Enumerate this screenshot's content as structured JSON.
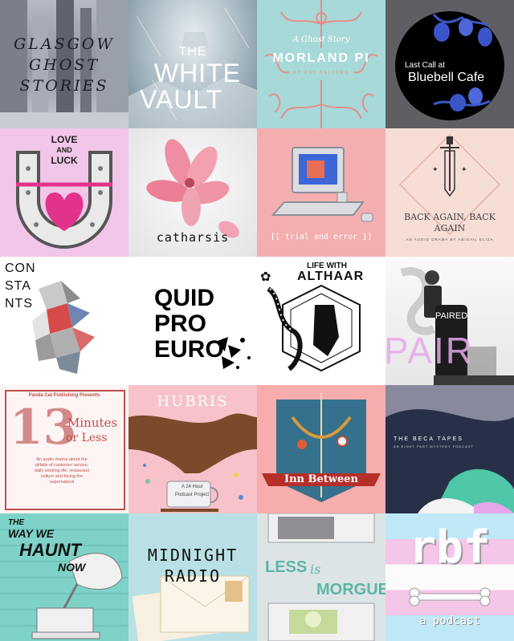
{
  "tiles": [
    {
      "name": "glasgow-ghost-stories",
      "lines": [
        "GLASGOW",
        "GHOST",
        "STORIES"
      ]
    },
    {
      "name": "the-white-vault",
      "lines": [
        "THE",
        "WHITE",
        "VAULT"
      ]
    },
    {
      "name": "morland-pi",
      "subtitle": "A Ghost Story",
      "title": "MORLAND PI",
      "byline": "BY RAY SELLERS"
    },
    {
      "name": "last-call-bluebell-cafe",
      "line1": "Last Call at",
      "line2": "Bluebell Cafe"
    },
    {
      "name": "love-and-luck",
      "lines": [
        "LOVE",
        "AND",
        "LUCK"
      ]
    },
    {
      "name": "catharsis",
      "title": "catharsis"
    },
    {
      "name": "trial-and-error",
      "title": "[[ trial and error ]]"
    },
    {
      "name": "back-again",
      "title": "BACK AGAIN, BACK",
      "title2": "AGAIN",
      "byline": "AN AUDIO DRAMA BY ABIGAIL ELIZA"
    },
    {
      "name": "constants",
      "lines": [
        "CON",
        "STA",
        "NTS"
      ]
    },
    {
      "name": "quid-pro-euro",
      "lines": [
        "QUID",
        "PRO",
        "EURO"
      ]
    },
    {
      "name": "life-with-althaar",
      "line1": "LIFE WITH",
      "line2": "ALTHAAR"
    },
    {
      "name": "paired",
      "title": "PAIRED",
      "big": "PAIR"
    },
    {
      "name": "13-minutes-or-less",
      "presents": "Panda Cat Publishing Presents",
      "number": "13",
      "words": "Minutes",
      "words2": "or Less",
      "desc": "An audio drama about the pitfalls of customer service, daily working life, restaurant culture and facing the supernatural"
    },
    {
      "name": "hubris",
      "title": "HUBRIS",
      "note1": "A 24 Hour",
      "note2": "Podcast Project"
    },
    {
      "name": "inn-between",
      "title": "Inn Between"
    },
    {
      "name": "the-beca-tapes",
      "title": "THE BECA TAPES",
      "sub": "AN EIGHT PART MYSTERY PODCAST"
    },
    {
      "name": "the-way-we-haunt-now",
      "lines": [
        "THE",
        "WAY WE",
        "HAUNT",
        "NOW"
      ]
    },
    {
      "name": "midnight-radio",
      "line1": "MIDNIGHT",
      "line2": "RADIO"
    },
    {
      "name": "less-is-morgue",
      "line1": "LESS",
      "line2": "is",
      "line3": "MORGUE"
    },
    {
      "name": "rbf",
      "title": "rbf",
      "sub": "a podcast"
    }
  ],
  "colors": {
    "blush": "#f2aeb0",
    "mint": "#8ed6d2",
    "lilac": "#f4c6e8",
    "navy": "#273047"
  }
}
